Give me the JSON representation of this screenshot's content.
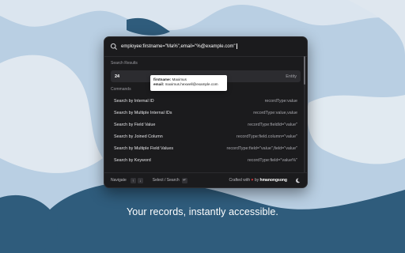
{
  "search": {
    "query": "employee:firstname=\"Ma%\",email=\"%@example.com\""
  },
  "sections": {
    "results_label": "Search Results",
    "commands_label": "Commands"
  },
  "result": {
    "value": "24",
    "type": "Entity"
  },
  "tooltip": {
    "firstname_key": "firstname:",
    "firstname_value": "Maximus",
    "email_key": "email:",
    "email_value": "maximus.hexwell@example.com"
  },
  "commands": [
    {
      "name": "Search by Internal ID",
      "hint": "recordType:value"
    },
    {
      "name": "Search by Multiple Internal IDs",
      "hint": "recordType:value,value"
    },
    {
      "name": "Search by Field Value",
      "hint": "recordType:fieldId=\"value\""
    },
    {
      "name": "Search by Joined Column",
      "hint": "recordType:field.column=\"value\""
    },
    {
      "name": "Search by Multiple Field Values",
      "hint": "recordType:field=\"value\",field=\"value\""
    },
    {
      "name": "Search by Keyword",
      "hint": "recordType:field=\"value%\""
    }
  ],
  "footer": {
    "navigate_label": "Navigate",
    "up_key": "↑",
    "down_key": "↓",
    "select_label": "Select / Search",
    "enter_key": "↵",
    "crafted_prefix": "Crafted with",
    "heart": "♥",
    "crafted_by": "by",
    "author": "hmanongsong"
  },
  "tagline": "Your records, instantly accessible.",
  "colors": {
    "background": "#b9cfe3",
    "blob_dark": "#2f5c7c",
    "blob_light": "#e9eef4",
    "palette_bg": "#1b1b1d",
    "heart": "#e0393e"
  }
}
